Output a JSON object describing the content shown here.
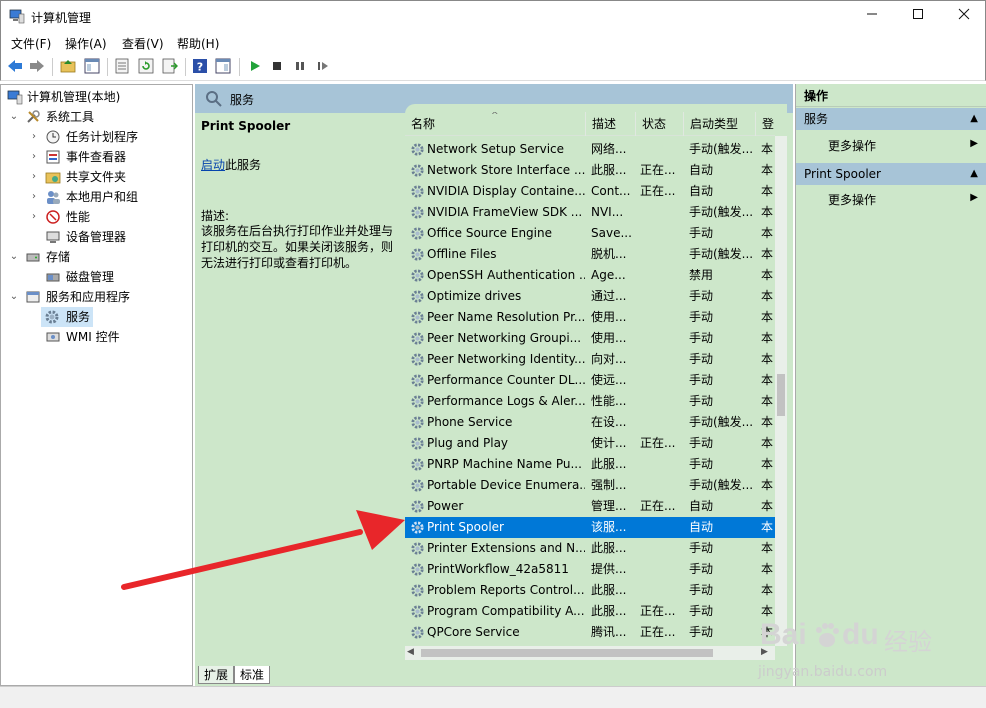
{
  "window": {
    "title": "计算机管理",
    "min_icon": "minimize-icon",
    "max_icon": "maximize-icon",
    "close_icon": "close-icon"
  },
  "menu": [
    "文件(F)",
    "操作(A)",
    "查看(V)",
    "帮助(H)"
  ],
  "tree": {
    "root": "计算机管理(本地)",
    "system_tools": "系统工具",
    "task_scheduler": "任务计划程序",
    "event_viewer": "事件查看器",
    "shared_folders": "共享文件夹",
    "local_users": "本地用户和组",
    "performance": "性能",
    "device_manager": "设备管理器",
    "storage": "存储",
    "disk_management": "磁盘管理",
    "services_apps": "服务和应用程序",
    "services": "服务",
    "wmi": "WMI 控件"
  },
  "panel_header": "服务",
  "description": {
    "service_name": "Print Spooler",
    "start_link": "启动",
    "start_suffix": "此服务",
    "desc_label": "描述:",
    "desc_text": "该服务在后台执行打印作业并处理与打印机的交互。如果关闭该服务，则无法进行打印或查看打印机。"
  },
  "columns": [
    "名称",
    "描述",
    "状态",
    "启动类型",
    "登"
  ],
  "services": [
    {
      "name": "Network Setup Service",
      "desc": "网络...",
      "status": "",
      "startup": "手动(触发...",
      "logon": "本"
    },
    {
      "name": "Network Store Interface ...",
      "desc": "此服...",
      "status": "正在...",
      "startup": "自动",
      "logon": "本"
    },
    {
      "name": "NVIDIA Display Containe...",
      "desc": "Cont...",
      "status": "正在...",
      "startup": "自动",
      "logon": "本"
    },
    {
      "name": "NVIDIA FrameView SDK ...",
      "desc": "NVI...",
      "status": "",
      "startup": "手动(触发...",
      "logon": "本"
    },
    {
      "name": "Office  Source Engine",
      "desc": "Save...",
      "status": "",
      "startup": "手动",
      "logon": "本"
    },
    {
      "name": "Offline Files",
      "desc": "脱机...",
      "status": "",
      "startup": "手动(触发...",
      "logon": "本"
    },
    {
      "name": "OpenSSH Authentication ...",
      "desc": "Age...",
      "status": "",
      "startup": "禁用",
      "logon": "本"
    },
    {
      "name": "Optimize drives",
      "desc": "通过...",
      "status": "",
      "startup": "手动",
      "logon": "本"
    },
    {
      "name": "Peer Name Resolution Pr...",
      "desc": "使用...",
      "status": "",
      "startup": "手动",
      "logon": "本"
    },
    {
      "name": "Peer Networking Groupi...",
      "desc": "使用...",
      "status": "",
      "startup": "手动",
      "logon": "本"
    },
    {
      "name": "Peer Networking Identity...",
      "desc": "向对...",
      "status": "",
      "startup": "手动",
      "logon": "本"
    },
    {
      "name": "Performance Counter DL...",
      "desc": "使远...",
      "status": "",
      "startup": "手动",
      "logon": "本"
    },
    {
      "name": "Performance Logs & Aler...",
      "desc": "性能...",
      "status": "",
      "startup": "手动",
      "logon": "本"
    },
    {
      "name": "Phone Service",
      "desc": "在设...",
      "status": "",
      "startup": "手动(触发...",
      "logon": "本"
    },
    {
      "name": "Plug and Play",
      "desc": "使计...",
      "status": "正在...",
      "startup": "手动",
      "logon": "本"
    },
    {
      "name": "PNRP Machine Name Pu...",
      "desc": "此服...",
      "status": "",
      "startup": "手动",
      "logon": "本"
    },
    {
      "name": "Portable Device Enumera...",
      "desc": "强制...",
      "status": "",
      "startup": "手动(触发...",
      "logon": "本"
    },
    {
      "name": "Power",
      "desc": "管理...",
      "status": "正在...",
      "startup": "自动",
      "logon": "本"
    },
    {
      "name": "Print Spooler",
      "desc": "该服...",
      "status": "",
      "startup": "自动",
      "logon": "本"
    },
    {
      "name": "Printer Extensions and N...",
      "desc": "此服...",
      "status": "",
      "startup": "手动",
      "logon": "本"
    },
    {
      "name": "PrintWorkflow_42a5811",
      "desc": "提供...",
      "status": "",
      "startup": "手动",
      "logon": "本"
    },
    {
      "name": "Problem Reports Control...",
      "desc": "此服...",
      "status": "",
      "startup": "手动",
      "logon": "本"
    },
    {
      "name": "Program Compatibility A...",
      "desc": "此服...",
      "status": "正在...",
      "startup": "手动",
      "logon": "本"
    },
    {
      "name": "QPCore Service",
      "desc": "腾讯...",
      "status": "正在...",
      "startup": "手动",
      "logon": "本"
    }
  ],
  "tabs": [
    "扩展",
    "标准"
  ],
  "actions": {
    "title": "操作",
    "group1": "服务",
    "group1_more": "更多操作",
    "group2": "Print Spooler",
    "group2_more": "更多操作"
  },
  "watermark": {
    "brand": "Bai",
    "brand2": "du",
    "cn": "经验",
    "url": "jingyan.baidu.com"
  },
  "colors": {
    "selection": "#0078d7",
    "panel_green": "#cde7ca",
    "header_blue": "#a7c4d7",
    "arrow_red": "#e8262a"
  }
}
